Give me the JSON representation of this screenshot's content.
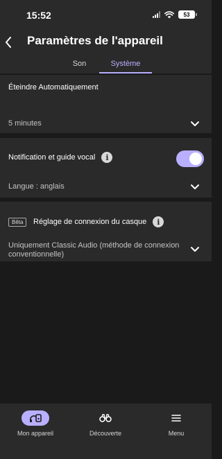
{
  "status_bar": {
    "time": "15:52",
    "battery": "53"
  },
  "header": {
    "title": "Paramètres de l'appareil"
  },
  "tabs": [
    {
      "label": "Son"
    },
    {
      "label": "Système"
    }
  ],
  "settings": {
    "auto_off": {
      "title": "Éteindre Automatiquement",
      "value": "5 minutes"
    },
    "voice_guide": {
      "title": "Notification et guide vocal",
      "enabled": true,
      "language": "Langue : anglais"
    },
    "connection": {
      "badge": "Bêta",
      "title": "Réglage de connexion du casque",
      "value": "Uniquement Classic Audio (méthode de connexion conventionnelle)"
    }
  },
  "bottom_nav": [
    {
      "label": "Mon appareil",
      "icon": "device-icon",
      "active": true
    },
    {
      "label": "Découverte",
      "icon": "binoculars-icon",
      "active": false
    },
    {
      "label": "Menu",
      "icon": "menu-icon",
      "active": false
    }
  ],
  "colors": {
    "accent": "#b8b0ff",
    "surface": "#2a2a2a",
    "background": "#1a1a1a"
  }
}
